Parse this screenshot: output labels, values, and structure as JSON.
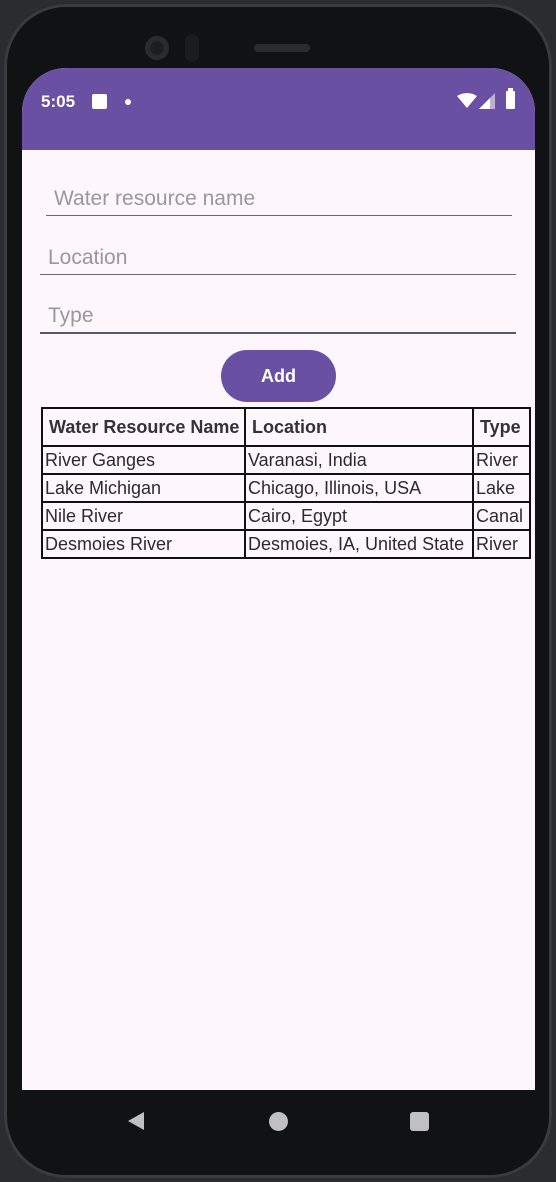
{
  "status_bar": {
    "time": "5:05",
    "color": "#6a50a2"
  },
  "form": {
    "name_placeholder": "Water resource name",
    "location_placeholder": "Location",
    "type_placeholder": "Type",
    "add_label": "Add"
  },
  "table": {
    "headers": {
      "name": "Water Resource Name",
      "location": "Location",
      "type": "Type"
    },
    "rows": [
      {
        "name": "River Ganges",
        "location": "Varanasi, India",
        "type": "River"
      },
      {
        "name": "Lake Michigan",
        "location": "Chicago, Illinois, USA",
        "type": "Lake"
      },
      {
        "name": "Nile River",
        "location": "Cairo, Egypt",
        "type": "Canal"
      },
      {
        "name": "Desmoies River",
        "location": "Desmoies, IA, United State",
        "type": "River"
      }
    ]
  },
  "icons": {
    "status": [
      "notification-square-icon",
      "notification-dot-icon",
      "wifi-icon",
      "signal-icon",
      "battery-icon"
    ],
    "nav": [
      "back-icon",
      "home-icon",
      "recents-icon"
    ]
  }
}
